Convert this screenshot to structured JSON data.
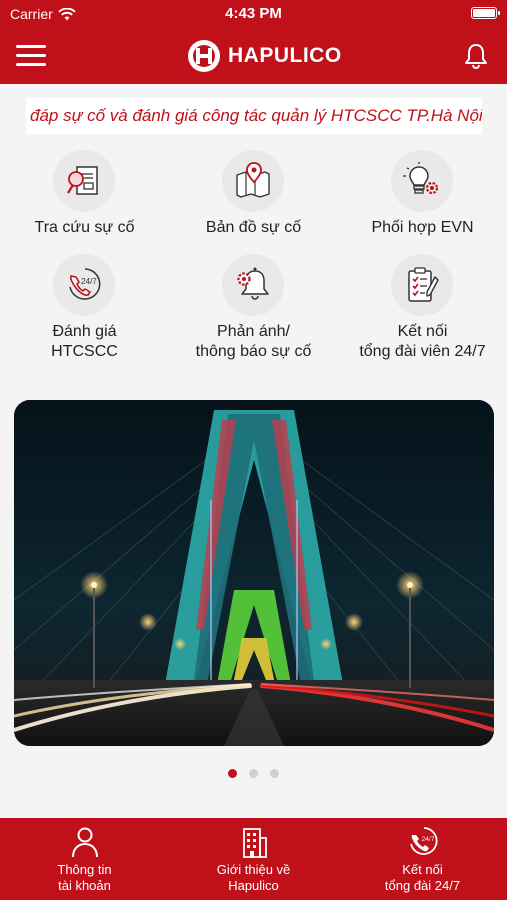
{
  "status": {
    "carrier": "Carrier",
    "time": "4:43 PM"
  },
  "header": {
    "title": "HAPULICO"
  },
  "marquee": {
    "text": "đáp sự cố và đánh giá công tác quản lý HTCSCC TP.Hà Nội"
  },
  "features": [
    {
      "line1": "Tra cứu sự cố",
      "line2": ""
    },
    {
      "line1": "Bản đồ sự cố",
      "line2": ""
    },
    {
      "line1": "Phối hợp EVN",
      "line2": ""
    },
    {
      "line1": "Đánh giá",
      "line2": "HTCSCC"
    },
    {
      "line1": "Phản ánh/",
      "line2": "thông báo sự cố"
    },
    {
      "line1": "Kết nối",
      "line2": "tổng đài viên 24/7"
    }
  ],
  "carousel": {
    "active_index": 0,
    "count": 3
  },
  "tabs": [
    {
      "line1": "Thông tin",
      "line2": "tài khoản"
    },
    {
      "line1": "Giới thiệu về",
      "line2": "Hapulico"
    },
    {
      "line1": "Kết nối",
      "line2": "tổng đài 24/7"
    }
  ],
  "icons": {
    "features": [
      "search-document-icon",
      "map-pin-icon",
      "lightbulb-gear-icon",
      "phone-24-7-icon",
      "bell-gear-icon",
      "checklist-pen-icon"
    ],
    "tabs": [
      "user-icon",
      "building-icon",
      "phone-24-7-icon"
    ]
  },
  "colors": {
    "brand": "#c0111b",
    "tile_bg": "#e9e9e9",
    "page_bg": "#f4f4f4"
  }
}
